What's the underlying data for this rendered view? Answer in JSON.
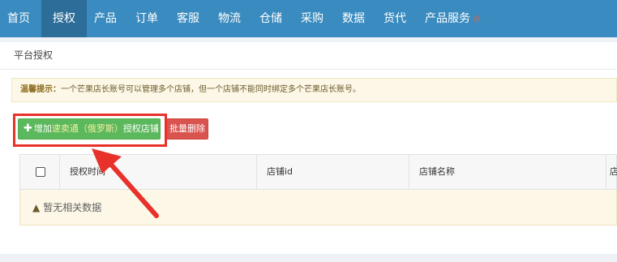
{
  "nav": {
    "items": [
      {
        "label": "首页"
      },
      {
        "label": "授权"
      },
      {
        "label": "产品"
      },
      {
        "label": "订单"
      },
      {
        "label": "客服"
      },
      {
        "label": "物流"
      },
      {
        "label": "仓储"
      },
      {
        "label": "采购"
      },
      {
        "label": "数据"
      },
      {
        "label": "货代"
      },
      {
        "label": "产品服务"
      }
    ],
    "active_index": 1
  },
  "panel": {
    "title": "平台授权"
  },
  "tip": {
    "label": "温馨提示：",
    "text": "一个芒果店长账号可以管理多个店铺，但一个店铺不能同时绑定多个芒果店长账号。"
  },
  "toolbar": {
    "add_prefix": "增加",
    "add_shop": "速卖通（俄罗斯）",
    "add_suffix": "授权店铺",
    "delete_label": "批量删除"
  },
  "table": {
    "columns": [
      "授权时间",
      "店铺id",
      "店铺名称",
      "店"
    ],
    "empty_text": "暂无相关数据"
  },
  "colors": {
    "nav_bg": "#3a8bbf",
    "nav_active": "#2c6e99",
    "add_button": "#5cb85c",
    "delete_button": "#d9534f",
    "annotation": "#e8312b"
  }
}
